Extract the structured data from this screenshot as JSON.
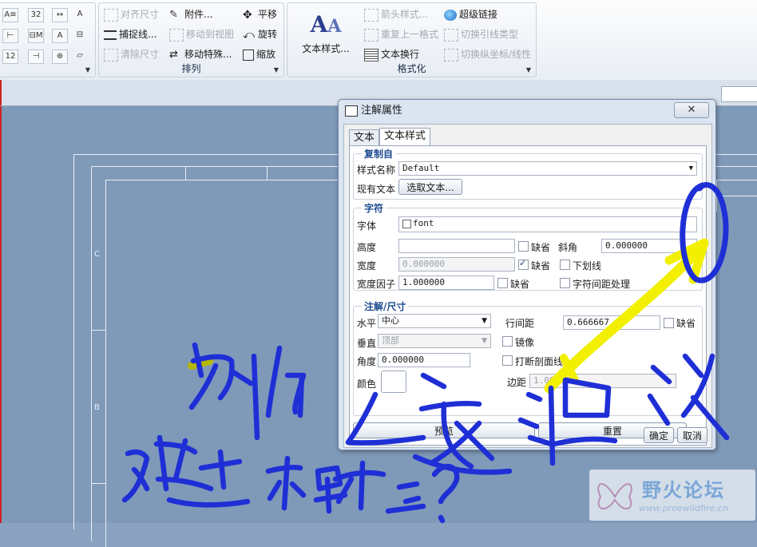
{
  "ribbon": {
    "group1_small": [
      "A≡",
      "32",
      "↔",
      "⊢",
      "⊟M",
      "A",
      "12",
      "⊣",
      "⊕",
      "A",
      "⊟",
      "▱"
    ],
    "group2": {
      "items": [
        {
          "label": "对齐尺寸",
          "disabled": true
        },
        {
          "label": "附件...",
          "disabled": false
        },
        {
          "label": "平移",
          "disabled": false
        },
        {
          "label": "捕捉线...",
          "disabled": false
        },
        {
          "label": "移动到视图",
          "disabled": true
        },
        {
          "label": "旋转",
          "disabled": false
        },
        {
          "label": "清除尺寸",
          "disabled": true
        },
        {
          "label": "移动特殊...",
          "disabled": false
        },
        {
          "label": "缩放",
          "disabled": false
        }
      ],
      "label": "排列"
    },
    "group3": {
      "big_label": "文本样式...",
      "items": [
        {
          "label": "箭头样式...",
          "disabled": true
        },
        {
          "label": "超级链接",
          "disabled": false
        },
        {
          "label": "重复上一格式",
          "disabled": true
        },
        {
          "label": "切换引线类型",
          "disabled": true
        },
        {
          "label": "文本换行",
          "disabled": false
        },
        {
          "label": "切换纵坐标/线性",
          "disabled": true
        }
      ],
      "label": "格式化"
    }
  },
  "canvas": {
    "markers": [
      "C",
      "B"
    ]
  },
  "dialog": {
    "title": "注解属性",
    "close": "✕",
    "tabs": [
      "文本",
      "文本样式"
    ],
    "copy_from": {
      "legend": "复制自",
      "style_name_label": "样式名称",
      "style_name_value": "Default",
      "existing_text_label": "现有文本",
      "select_text_button": "选取文本..."
    },
    "character": {
      "legend": "字符",
      "font_label": "字体",
      "font_value": "font",
      "height_label": "高度",
      "height_value": "",
      "default_label": "缺省",
      "slant_label": "斜角",
      "slant_value": "0.000000",
      "width_label": "宽度",
      "width_value": "0.000000",
      "underline_label": "下划线",
      "width_factor_label": "宽度因子",
      "width_factor_value": "1.000000",
      "kerning_label": "字符间距处理"
    },
    "note_dim": {
      "legend": "注解/尺寸",
      "horizontal_label": "水平",
      "horizontal_value": "中心",
      "line_spacing_label": "行间距",
      "line_spacing_value": "0.666667",
      "vertical_label": "垂直",
      "vertical_value": "顶部",
      "mirror_label": "镜像",
      "angle_label": "角度",
      "angle_value": "0.000000",
      "break_hatch_label": "打断剖面线",
      "color_label": "颜色",
      "margin_label": "边距",
      "margin_value": "1.000000"
    },
    "preview_button": "预览",
    "reset_button": "重置",
    "ok_button": "确定",
    "cancel_button": "取消"
  },
  "watermark": {
    "title": "野火论坛",
    "url": "www.proewildfire.cn"
  },
  "colors": {
    "ink_blue": "#1f2fd6",
    "ink_yellow": "#f2f000",
    "legend_blue": "#1f4d91"
  }
}
